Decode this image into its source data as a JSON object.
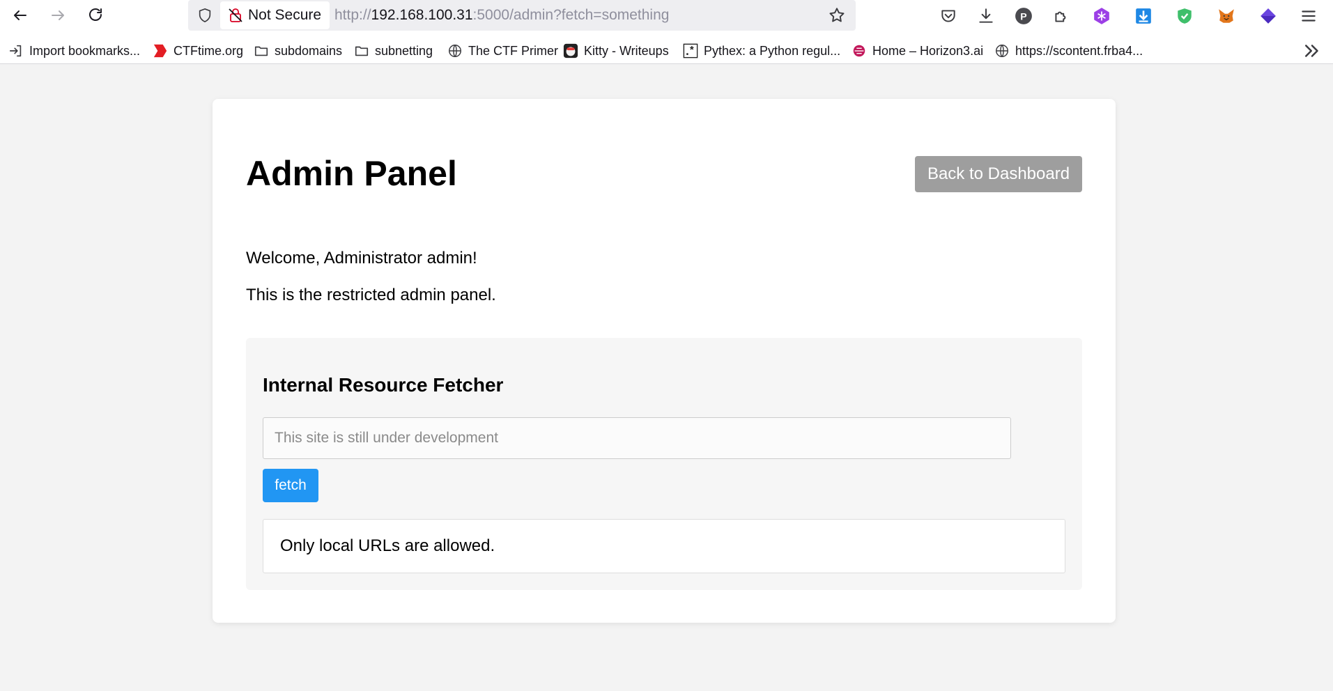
{
  "browser": {
    "security_label": "Not Secure",
    "url_prefix": "http://",
    "url_host": "192.168.100.31",
    "url_rest": ":5000/admin?fetch=something",
    "bookmarks": [
      "Import bookmarks...",
      "CTFtime.org",
      "subdomains",
      "subnetting",
      "The CTF Primer",
      "Kitty - Writeups",
      "Pythex: a Python regul...",
      "Home – Horizon3.ai",
      "https://scontent.frba4..."
    ],
    "extensions": [
      "pocket-icon",
      "downloads-icon",
      "p-extension-icon",
      "extensions-puzzle-icon",
      "snowflake-extension-icon",
      "download-arrow-extension-icon",
      "shield-check-extension-icon",
      "metamask-fox-icon",
      "purple-diamond-extension-icon",
      "menu-icon"
    ]
  },
  "page": {
    "title": "Admin Panel",
    "back_button": "Back to Dashboard",
    "welcome": "Welcome, Administrator admin!",
    "restricted_text": "This is the restricted admin panel.",
    "fetcher": {
      "title": "Internal Resource Fetcher",
      "placeholder": "This site is still under development",
      "button": "fetch",
      "result": "Only local URLs are allowed."
    }
  },
  "colors": {
    "page_bg": "#f3f3f3",
    "back_button_bg": "#9e9e9e",
    "fetch_button_bg": "#2196f3"
  }
}
